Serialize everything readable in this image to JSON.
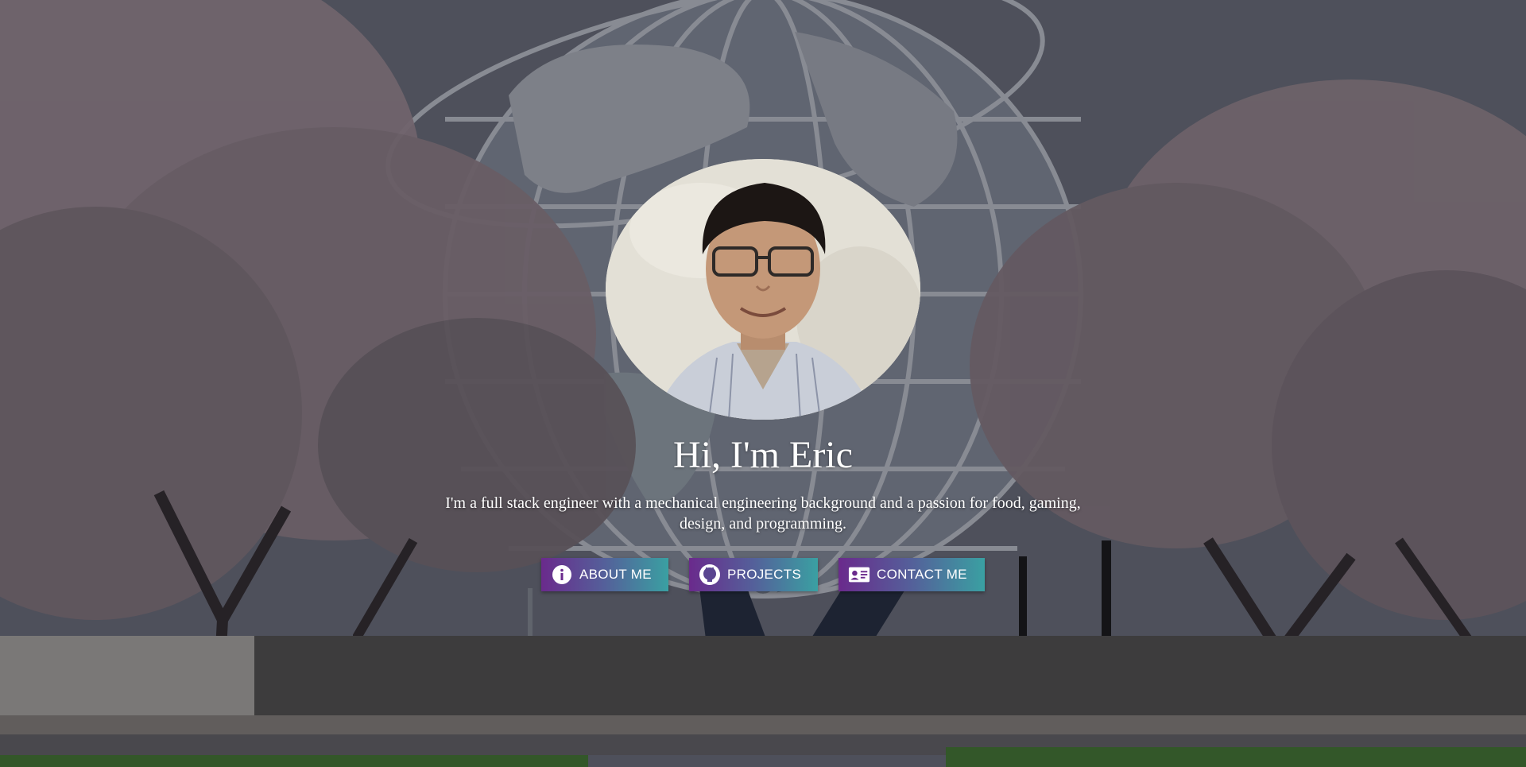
{
  "hero": {
    "title": "Hi, I'm Eric",
    "tagline": "I'm a full stack engineer with a mechanical engineering background and a passion for food, gaming, design, and programming.",
    "avatar_alt": "Portrait of Eric",
    "background": "unisphere-cherry-blossoms-photo"
  },
  "buttons": [
    {
      "label": "ABOUT ME",
      "icon": "info-icon"
    },
    {
      "label": "PROJECTS",
      "icon": "github-icon"
    },
    {
      "label": "CONTACT ME",
      "icon": "contact-card-icon"
    }
  ],
  "colors": {
    "button_gradient_start": "#6a2a8c",
    "button_gradient_end": "#3aa0a2",
    "text": "#ffffff"
  }
}
